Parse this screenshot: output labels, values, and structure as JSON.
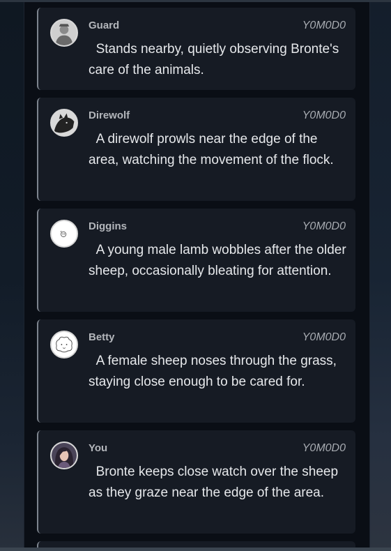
{
  "messages": [
    {
      "name": "Guard",
      "timestamp": "Y0M0D0",
      "text": "  Stands nearby, quietly observing Bronte's care of the animals.",
      "avatar_icon": "guard-avatar-icon"
    },
    {
      "name": "Direwolf",
      "timestamp": "Y0M0D0",
      "text": "  A direwolf prowls near the edge of the area, watching the movement of the flock.",
      "avatar_icon": "direwolf-avatar-icon"
    },
    {
      "name": "Diggins",
      "timestamp": "Y0M0D0",
      "text": "  A young male lamb wobbles after the older sheep, occasionally bleating for attention.",
      "avatar_icon": "lamb-avatar-icon"
    },
    {
      "name": "Betty",
      "timestamp": "Y0M0D0",
      "text": "  A female sheep noses through the grass, staying close enough to be cared for.",
      "avatar_icon": "sheep-avatar-icon"
    },
    {
      "name": "You",
      "timestamp": "Y0M0D0",
      "text": "  Bronte keeps close watch over the sheep as they graze near the edge of the area.",
      "avatar_icon": "user-avatar-icon"
    }
  ]
}
